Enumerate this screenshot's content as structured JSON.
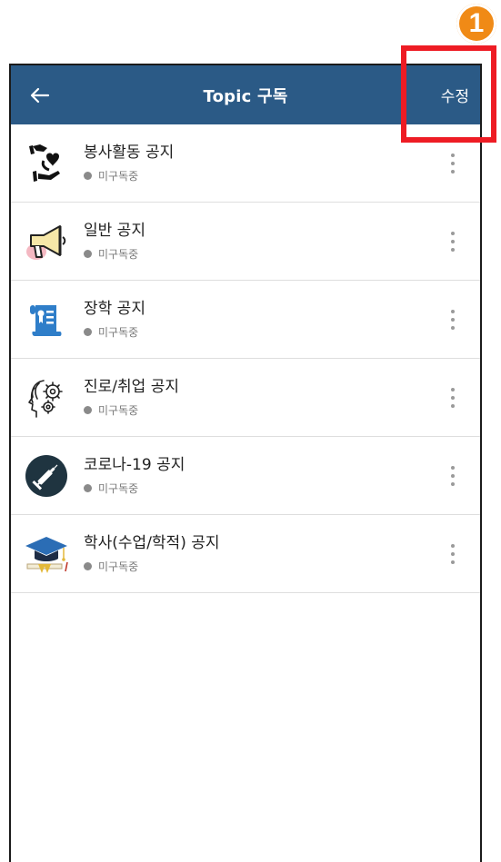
{
  "annotation": {
    "badge_label": "1",
    "highlight_color": "#ee1c24",
    "badge_color": "#f08a16"
  },
  "app_bar": {
    "title": "Topic 구독",
    "back_icon": "arrow-left-icon",
    "edit_label": "수정",
    "background_color": "#2b5a86"
  },
  "topics": [
    {
      "title": "봉사활동 공지",
      "status": "미구독중",
      "icon": "hand-heart-icon"
    },
    {
      "title": "일반 공지",
      "status": "미구독중",
      "icon": "megaphone-icon"
    },
    {
      "title": "장학 공지",
      "status": "미구독중",
      "icon": "certificate-scroll-icon"
    },
    {
      "title": "진로/취업 공지",
      "status": "미구독중",
      "icon": "head-gears-icon"
    },
    {
      "title": "코로나-19 공지",
      "status": "미구독중",
      "icon": "syringe-icon"
    },
    {
      "title": "학사(수업/학적) 공지",
      "status": "미구독중",
      "icon": "graduation-cap-icon"
    }
  ],
  "more_icon": "more-vertical-icon"
}
